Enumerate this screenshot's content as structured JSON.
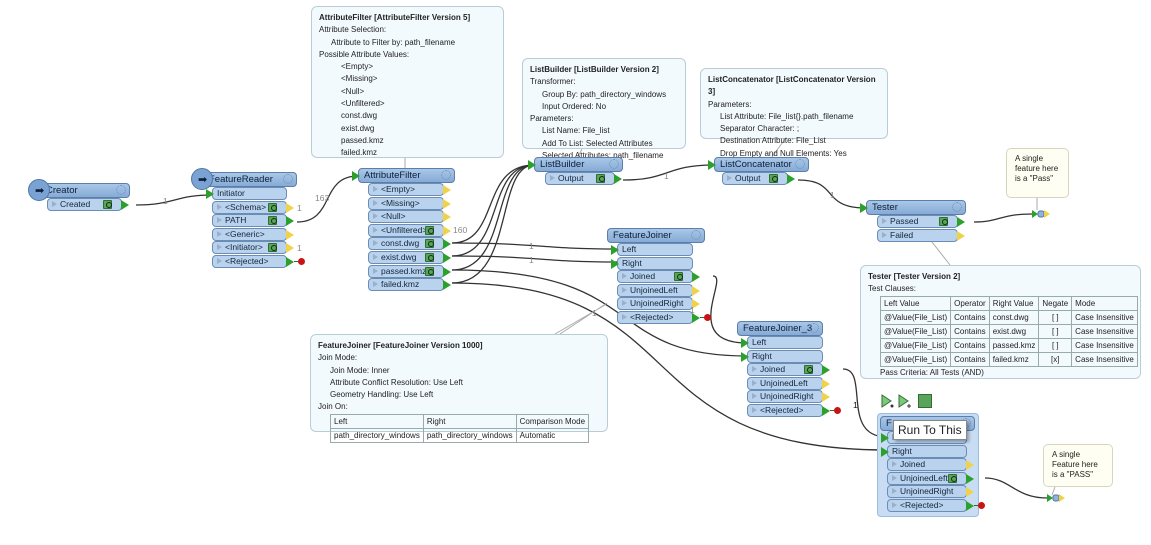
{
  "nodes": [
    {
      "id": "creator",
      "name": "Creator",
      "icon": "creator-icon",
      "inputs": [],
      "outputs": [
        {
          "label": "Created",
          "inspect": true,
          "state": "connected"
        }
      ]
    },
    {
      "id": "featurereader",
      "name": "FeatureReader",
      "icon": "database-reader-icon",
      "inputs": [
        "Initiator"
      ],
      "outputs": [
        {
          "label": "<Schema>",
          "inspect": true,
          "state": "unconnected"
        },
        {
          "label": "PATH",
          "inspect": true,
          "state": "connected"
        },
        {
          "label": "<Generic>",
          "inspect": false,
          "state": "unconnected"
        },
        {
          "label": "<Initiator>",
          "inspect": true,
          "state": "unconnected"
        },
        {
          "label": "<Rejected>",
          "inspect": false,
          "state": "rejected"
        }
      ]
    },
    {
      "id": "attributefilter",
      "name": "AttributeFilter",
      "inputs": [],
      "header_input": true,
      "outputs": [
        {
          "label": "<Empty>",
          "inspect": false,
          "state": "unconnected"
        },
        {
          "label": "<Missing>",
          "inspect": false,
          "state": "unconnected"
        },
        {
          "label": "<Null>",
          "inspect": false,
          "state": "unconnected"
        },
        {
          "label": "<Unfiltered>",
          "inspect": true,
          "state": "unconnected"
        },
        {
          "label": "const.dwg",
          "inspect": true,
          "state": "connected"
        },
        {
          "label": "exist.dwg",
          "inspect": true,
          "state": "connected"
        },
        {
          "label": "passed.kmz",
          "inspect": true,
          "state": "connected"
        },
        {
          "label": "failed.kmz",
          "inspect": false,
          "state": "connected"
        }
      ]
    },
    {
      "id": "listbuilder",
      "name": "ListBuilder",
      "inputs": [],
      "header_input": true,
      "outputs": [
        {
          "label": "Output",
          "inspect": true,
          "state": "connected"
        }
      ]
    },
    {
      "id": "listconcatenator",
      "name": "ListConcatenator",
      "inputs": [],
      "header_input": true,
      "outputs": [
        {
          "label": "Output",
          "inspect": true,
          "state": "connected"
        }
      ]
    },
    {
      "id": "tester",
      "name": "Tester",
      "inputs": [],
      "header_input": true,
      "outputs": [
        {
          "label": "Passed",
          "inspect": true,
          "state": "connected"
        },
        {
          "label": "Failed",
          "inspect": false,
          "state": "unconnected"
        }
      ]
    },
    {
      "id": "featurejoiner",
      "name": "FeatureJoiner",
      "inputs": [
        "Left",
        "Right"
      ],
      "outputs": [
        {
          "label": "Joined",
          "inspect": true,
          "state": "connected"
        },
        {
          "label": "UnjoinedLeft",
          "inspect": false,
          "state": "unconnected"
        },
        {
          "label": "UnjoinedRight",
          "inspect": false,
          "state": "unconnected"
        },
        {
          "label": "<Rejected>",
          "inspect": false,
          "state": "rejected"
        }
      ]
    },
    {
      "id": "featurejoiner3",
      "name": "FeatureJoiner_3",
      "inputs": [
        "Left",
        "Right"
      ],
      "outputs": [
        {
          "label": "Joined",
          "inspect": true,
          "state": "connected"
        },
        {
          "label": "UnjoinedLeft",
          "inspect": false,
          "state": "unconnected"
        },
        {
          "label": "UnjoinedRight",
          "inspect": false,
          "state": "unconnected"
        },
        {
          "label": "<Rejected>",
          "inspect": false,
          "state": "rejected"
        }
      ]
    },
    {
      "id": "featurejoinersel",
      "name": "F",
      "selected": true,
      "inputs": [
        "Left",
        "Right"
      ],
      "outputs": [
        {
          "label": "Joined",
          "inspect": false,
          "state": "unconnected"
        },
        {
          "label": "UnjoinedLeft",
          "inspect": true,
          "state": "connected"
        },
        {
          "label": "UnjoinedRight",
          "inspect": false,
          "state": "unconnected"
        },
        {
          "label": "<Rejected>",
          "inspect": false,
          "state": "rejected"
        }
      ]
    }
  ],
  "annotations": {
    "attributefilter": {
      "title": "AttributeFilter [AttributeFilter Version 5]",
      "sections": [
        {
          "heading": "Attribute Selection:",
          "items": [
            "Attribute to Filter by: path_filename"
          ]
        },
        {
          "heading": "Possible Attribute Values:",
          "items": [
            "<Empty>",
            "<Missing>",
            "<Null>",
            "<Unfiltered>",
            "const.dwg",
            "exist.dwg",
            "passed.kmz",
            "failed.kmz"
          ]
        }
      ]
    },
    "listbuilder": {
      "title": "ListBuilder [ListBuilder Version 2]",
      "sections": [
        {
          "heading": "Transformer:",
          "items": [
            "Group By: path_directory_windows",
            "Input Ordered: No"
          ]
        },
        {
          "heading": "Parameters:",
          "items": [
            "List Name: File_list",
            "Add To List: Selected Attributes",
            "Selected Attributes: path_filename"
          ]
        }
      ]
    },
    "listconcatenator": {
      "title": "ListConcatenator [ListConcatenator Version 3]",
      "sections": [
        {
          "heading": "Parameters:",
          "items": [
            "List Attribute: File_list{}.path_filename",
            "Separator Character: ;",
            "Destination Attribute: File_List",
            "Drop Empty and Null Elements: Yes"
          ]
        }
      ]
    },
    "tester": {
      "title": "Tester [Tester Version 2]",
      "heading": "Test Clauses:",
      "table": {
        "headers": [
          "Left Value",
          "Operator",
          "Right Value",
          "Negate",
          "Mode"
        ],
        "rows": [
          [
            "@Value(File_List)",
            "Contains",
            "const.dwg",
            "[ ]",
            "Case Insensitive"
          ],
          [
            "@Value(File_List)",
            "Contains",
            "exist.dwg",
            "[ ]",
            "Case Insensitive"
          ],
          [
            "@Value(File_List)",
            "Contains",
            "passed.kmz",
            "[ ]",
            "Case Insensitive"
          ],
          [
            "@Value(File_List)",
            "Contains",
            "failed.kmz",
            "[x]",
            "Case Insensitive"
          ]
        ]
      },
      "footer": "Pass Criteria: All Tests (AND)"
    },
    "featurejoiner": {
      "title": "FeatureJoiner [FeatureJoiner Version 1000]",
      "sections": [
        {
          "heading": "Join Mode:",
          "items": [
            "Join Mode: Inner",
            "Attribute Conflict Resolution: Use Left",
            "Geometry Handling: Use Left"
          ]
        },
        {
          "heading": "Join On:",
          "items": []
        }
      ],
      "table": {
        "headers": [
          "Left",
          "Right",
          "Comparison Mode"
        ],
        "rows": [
          [
            "path_directory_windows",
            "path_directory_windows",
            "Automatic"
          ]
        ]
      }
    }
  },
  "notes": {
    "pass_note_1": "A single feature here is a \"Pass\"",
    "pass_note_2": "A single Feature here is a \"PASS\""
  },
  "feature_counts": {
    "creator_to_reader": "1",
    "path_to_filter": "163",
    "schema": "1",
    "initiator": "1",
    "unfiltered": "160",
    "lb_to_lc": "1",
    "lc_to_tester": "1",
    "const_to_left": "1",
    "exist_to_right": "1",
    "failed_to_sel": "1",
    "joined_to_fj3": "1",
    "fj3_to_sel": "1"
  },
  "tooltip": "Run To This",
  "toolbar": [
    "run-to-this-icon",
    "run-from-this-icon",
    "inspect-icon"
  ],
  "colors": {
    "port_connected": "#2ca02c",
    "port_unconnected": "#f0d24a",
    "rejected": "#c81414",
    "header": "#86abd6",
    "port": "#b9d3ee"
  }
}
